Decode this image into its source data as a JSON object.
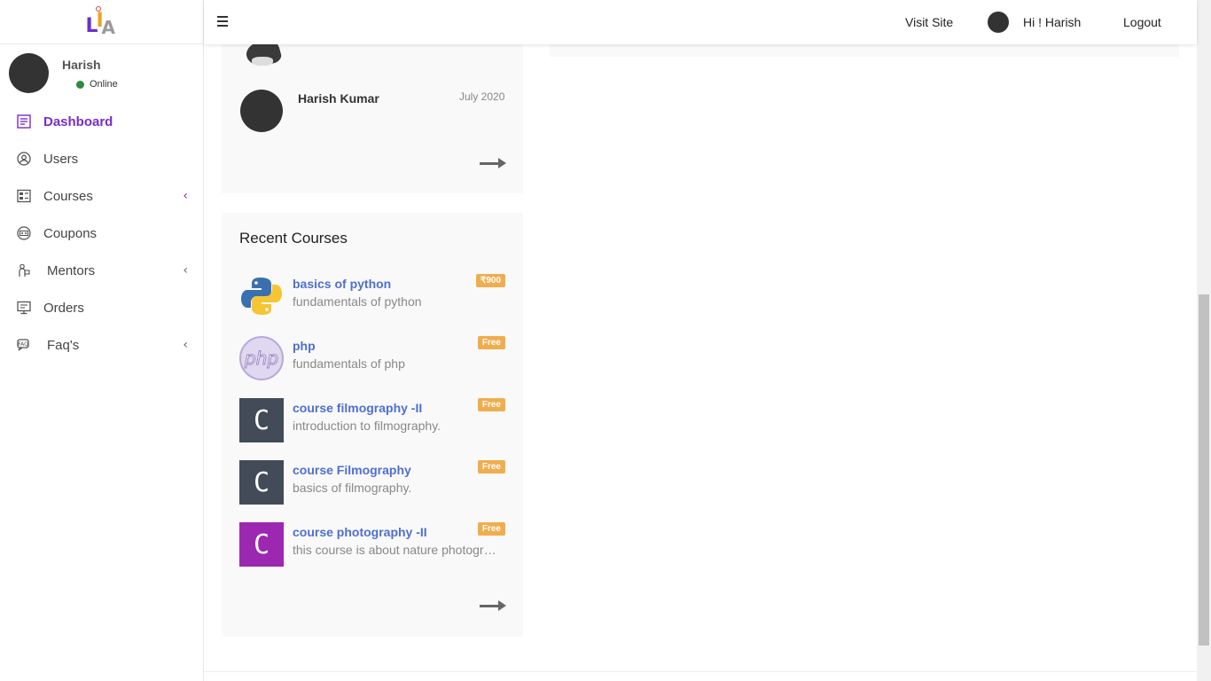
{
  "brand": {
    "letters": [
      "L",
      "I",
      "A"
    ]
  },
  "header": {
    "visit_site": "Visit Site",
    "greeting": "Hi ! Harish",
    "logout": "Logout"
  },
  "user": {
    "name": "Harish",
    "status": "Online"
  },
  "sidebar": {
    "items": [
      {
        "label": "Dashboard",
        "icon": "dashboard-icon",
        "active": true
      },
      {
        "label": "Users",
        "icon": "user-circle-icon"
      },
      {
        "label": "Courses",
        "icon": "courses-icon",
        "has_submenu": true
      },
      {
        "label": "Coupons",
        "icon": "coupon-icon"
      },
      {
        "label": "Mentors",
        "icon": "mentor-icon",
        "has_submenu": true
      },
      {
        "label": "Orders",
        "icon": "orders-icon"
      },
      {
        "label": "Faq's",
        "icon": "faq-icon",
        "has_submenu": true
      }
    ]
  },
  "mentors_card": {
    "mentor": {
      "name": "Harish Kumar",
      "date": "July 2020"
    }
  },
  "recent_courses": {
    "title": "Recent Courses",
    "items": [
      {
        "name": "basics of python",
        "desc": "fundamentals of python",
        "badge": "₹900",
        "thumb": "python-logo-icon"
      },
      {
        "name": "php",
        "desc": "fundamentals of php",
        "badge": "Free",
        "thumb": "php-logo-icon"
      },
      {
        "name": "course filmography -II",
        "desc": "introduction to filmography.",
        "badge": "Free",
        "thumb": "letter-c-icon",
        "thumb_letter": "C"
      },
      {
        "name": "course Filmography",
        "desc": "basics of filmography.",
        "badge": "Free",
        "thumb": "letter-c-icon",
        "thumb_letter": "C"
      },
      {
        "name": "course photography -II",
        "desc": "this course is about nature photography",
        "badge": "Free",
        "thumb": "letter-c-icon",
        "thumb_letter": "C"
      }
    ]
  },
  "colors": {
    "accent": "#7b2cc7",
    "link": "#4f6fd0",
    "badge": "#f0ad4e",
    "online": "#2e8b3f"
  }
}
